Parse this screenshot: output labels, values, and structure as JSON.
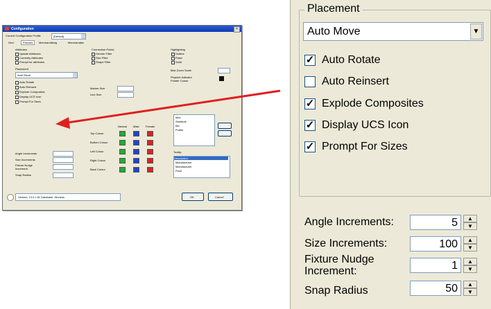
{
  "thumbnail": {
    "title": "Configuration",
    "top_combo": "Current Configuration Profile",
    "top_combo_value": "[Default]",
    "tabs": [
      "Grid",
      "Fixtures",
      "Merchandising",
      "Merchandise"
    ],
    "attributes_title": "Attributes",
    "attributes": [
      "Update Attributes",
      "Currently Attributes",
      "Prompt for attributes"
    ],
    "placement_title": "Placement",
    "placement_value": "Auto Move",
    "placement_checks": [
      "Auto Rotate",
      "Auto Reinsert",
      "Explode Composites",
      "Display UCS Icon",
      "Prompt For Sizes"
    ],
    "connection_title": "Connection Points",
    "connection_checks": [
      "Gender Filter",
      "Size Filter",
      "Shape Filter"
    ],
    "marker_size": "Marker Size",
    "line_size": "Line Size",
    "highlighting_title": "Highlighting",
    "highlighting_opts": [
      "Outline",
      "Flash",
      "Solid"
    ],
    "max_zoom": "Max Zoom Scale",
    "pointer_label": "Pinpoint Indicator",
    "pointer_label2": "Pointer Colour",
    "colour_headers": [
      "Neutral",
      "Male",
      "Female"
    ],
    "colour_rows": [
      "Top Colour",
      "Bottom Colour",
      "Left Colour",
      "Right Colour",
      "Back Colour"
    ],
    "list_items": [
      "Mex",
      "Shelfedit",
      "Bin",
      "Profile"
    ],
    "tooltip_title": "Tooltip",
    "tooltip_items": [
      "Description",
      "Manufacturer",
      "Manufacturer",
      "Price"
    ],
    "spin_labels": [
      "Angle Increments",
      "Size Increments",
      "Fixture Nudge",
      "Increment",
      "Snap Radius"
    ],
    "status": "Version: 13.0 x 81 Database: Hioness",
    "ok": "OK",
    "cancel": "Cancel"
  },
  "zoom": {
    "legend": "Placement",
    "combo_value": "Auto Move",
    "checkboxes": [
      {
        "label": "Auto Rotate",
        "checked": true
      },
      {
        "label": "Auto Reinsert",
        "checked": false
      },
      {
        "label": "Explode Composites",
        "checked": true
      },
      {
        "label": "Display UCS Icon",
        "checked": true
      },
      {
        "label": "Prompt For Sizes",
        "checked": true
      }
    ],
    "spinners": [
      {
        "label": "Angle Increments:",
        "value": "5"
      },
      {
        "label": "Size Increments:",
        "value": "100"
      },
      {
        "label": "Fixture Nudge\nIncrement:",
        "value": "1"
      },
      {
        "label": "Snap Radius",
        "value": "50"
      }
    ]
  },
  "colors": {
    "arrow": "#e02020",
    "swatch_green": "#22aa33",
    "swatch_blue": "#2244cc",
    "swatch_red": "#dd2222"
  }
}
